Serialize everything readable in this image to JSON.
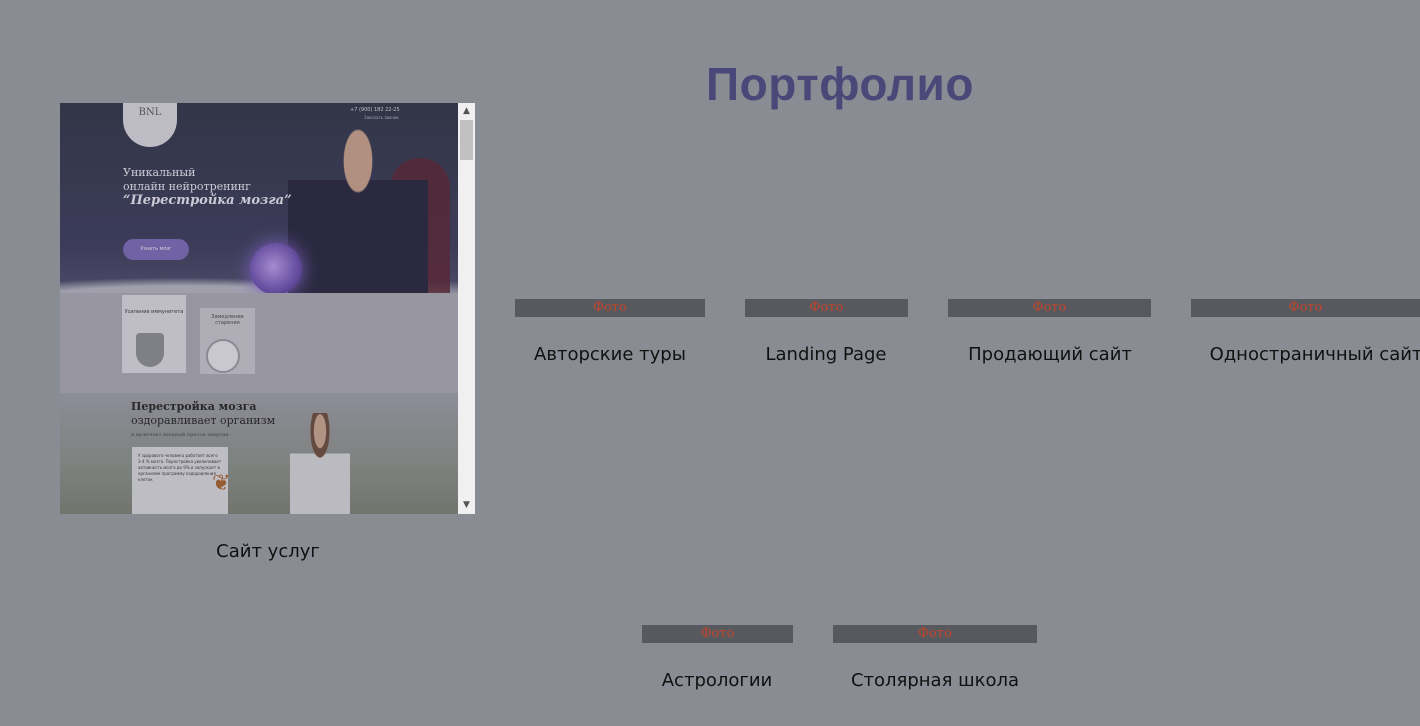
{
  "page": {
    "title": "Портфолио"
  },
  "featured": {
    "caption": "Сайт услуг",
    "preview": {
      "logo": "BNL",
      "phone": "+7 (900) 182 22-25",
      "callback": "Заказать звонок",
      "heading_line1": "Уникальный",
      "heading_line2": "онлайн нейротренинг",
      "heading_line3": "“Перестройка мозга”",
      "button": "Узнать мозг",
      "card1": "Усиление иммунитета",
      "card2": "Замедление старения",
      "heading2_line1": "Перестройка мозга",
      "heading2_line2": "оздоравливает организм",
      "heading2_sub": "и включает мощный приток энергии",
      "textbox": "У здорового человека работает всего 3-4 % мозга. Перестройка увеличивает активность мозга до 9% и запускает в организме программу оздоровления клеток"
    }
  },
  "projects": [
    {
      "photo_label": "Фото",
      "caption": "Авторские туры"
    },
    {
      "photo_label": "Фото",
      "caption": "Landing Page"
    },
    {
      "photo_label": "Фото",
      "caption": "Продающий сайт"
    },
    {
      "photo_label": "Фото",
      "caption": "Одностраничный сайт"
    },
    {
      "photo_label": "Фото",
      "caption": "Астрологии"
    },
    {
      "photo_label": "Фото",
      "caption": "Столярная школа"
    }
  ],
  "colors": {
    "background": "#8a8c94",
    "title": "#4a4878",
    "photo_bar": "#58595e",
    "photo_label": "#c0452c"
  },
  "icons": {
    "scroll_up": "chevron-up-icon",
    "scroll_down": "chevron-down-icon"
  }
}
